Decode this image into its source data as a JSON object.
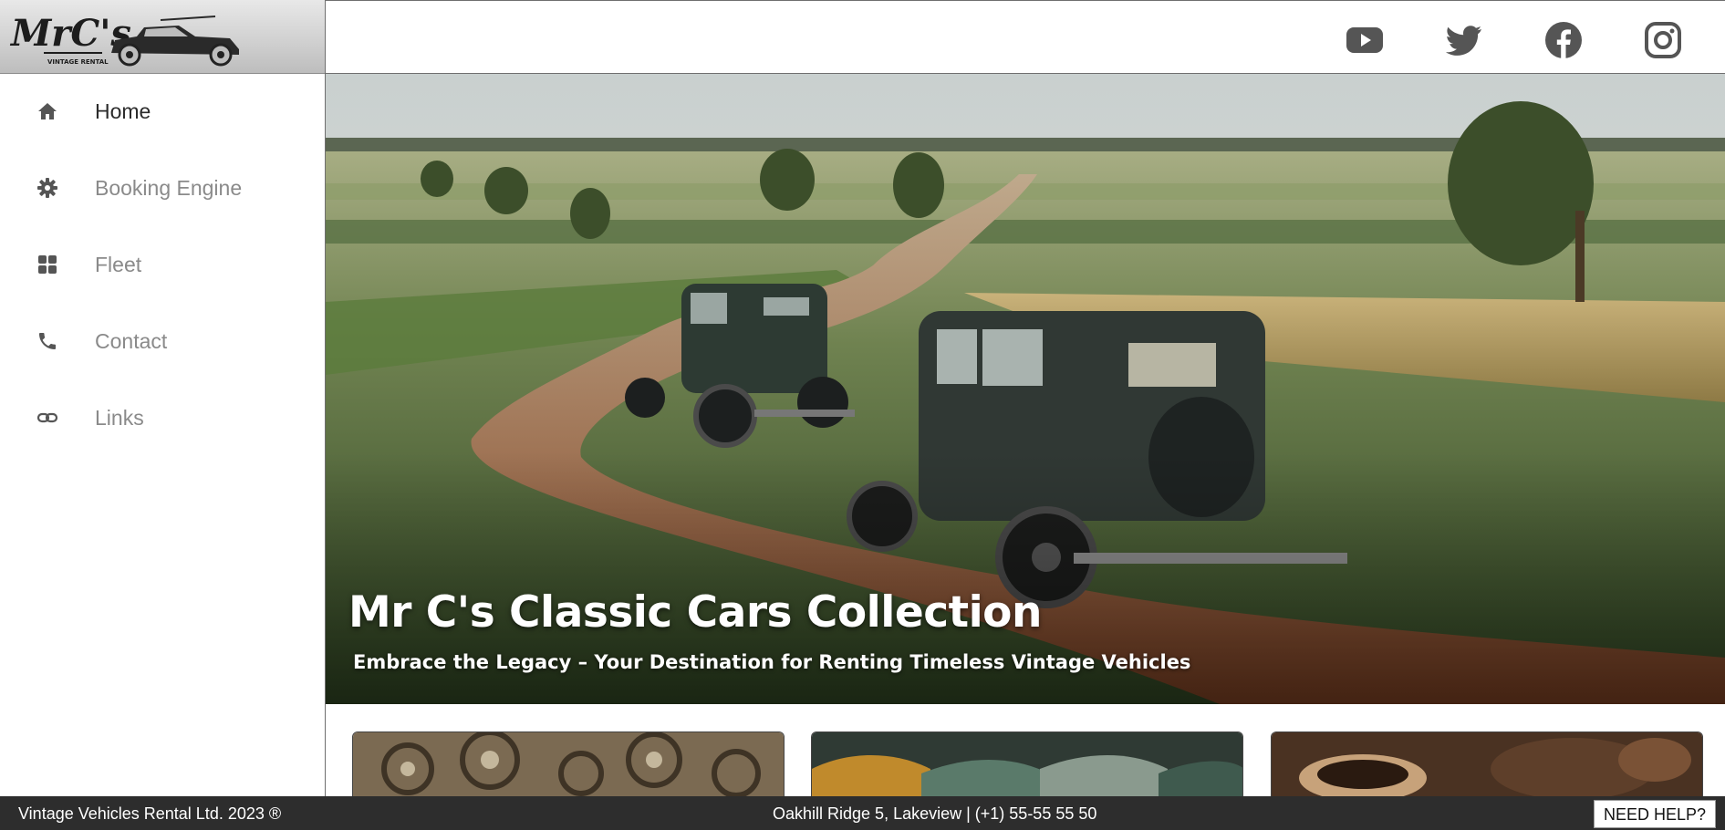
{
  "brand": {
    "logo_text": "MrC's",
    "logo_tagline": "VINTAGE RENTAL"
  },
  "sidebar": {
    "items": [
      {
        "label": "Home",
        "icon": "home-icon",
        "active": true
      },
      {
        "label": "Booking Engine",
        "icon": "gear-icon",
        "active": false
      },
      {
        "label": "Fleet",
        "icon": "grid-icon",
        "active": false
      },
      {
        "label": "Contact",
        "icon": "phone-icon",
        "active": false
      },
      {
        "label": "Links",
        "icon": "link-icon",
        "active": false
      }
    ]
  },
  "header": {
    "social": [
      {
        "icon": "youtube-icon"
      },
      {
        "icon": "twitter-icon"
      },
      {
        "icon": "facebook-icon"
      },
      {
        "icon": "instagram-icon"
      }
    ]
  },
  "hero": {
    "title": "Mr C's Classic Cars Collection",
    "subtitle": "Embrace the Legacy – Your Destination for Renting Timeless Vintage Vehicles"
  },
  "footer": {
    "copyright": "Vintage Vehicles Rental Ltd. 2023 ®",
    "address": "Oakhill Ridge 5, Lakeview | (+1) 55-55 55 50",
    "help_label": "NEED HELP?"
  },
  "colors": {
    "icon_gray": "#555555",
    "nav_active": "#2b2b2b",
    "nav_inactive": "#8a8a8a",
    "footer_bg": "#2d2d2d"
  }
}
